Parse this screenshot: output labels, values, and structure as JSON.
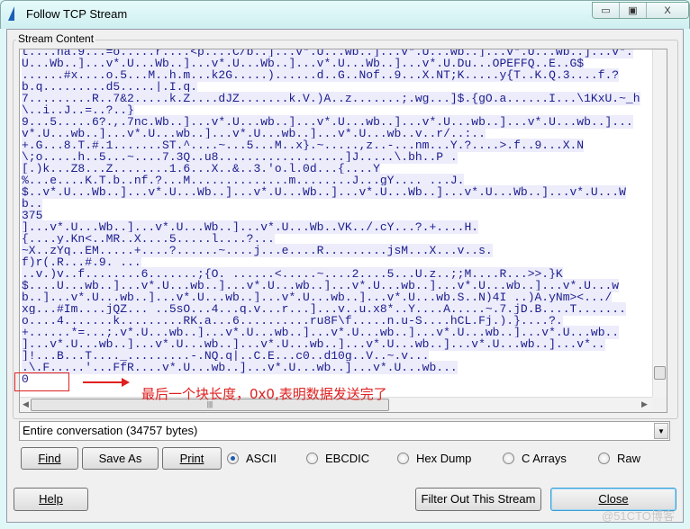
{
  "window": {
    "title": "Follow TCP Stream",
    "minimize": "▭",
    "maximize": "▣",
    "close": "X"
  },
  "group_label": "Stream Content",
  "stream_lines": [
    "t....ha.9...=o.....r....<p....C/b..]...v*.U...wb..]...v*.U...wb..]...v*.U...wb..]...v*.",
    "U...Wb..]...v*.U...Wb..]...v*.U...Wb..]...v*.U...Wb..]...v*.U.Du...OPEFFQ..E..G$",
    "......#x....o.5...M..h.m...k2G.....)......d..G..Nof..9...X.NT;K.....y{T..K.Q.3....f.?",
    "b.q.........d5.....|.I.q.",
    "7.........R..7&2.....k.Z....dJZ.......k.V.)A..z.......;.wg...]$.{gO.a......I...\\1KxU.~_h",
    "\\..i..J..=..?..}",
    "9...5.....6?.,.7nc.Wb..]...v*.U...wb..]...v*.U...wb..]...v*.U...wb..]...v*.U...wb..]...",
    "v*.U...wb..]...v*.U...wb..]...v*.U...wb..]...v*.U...wb..v..r/..:..",
    "+.G...8.T.#.1.......ST.^....~...5...M..x}.~.....,z..-...nm...Y.?....>.f..9...X.N",
    "\\;o.....h..5...~....7.3Q..u8..................]J.....\\.bh..P .",
    "[.)k...Z8...Z........1.6...X..&..3.'o.l.0d...{....Y",
    "%...e....K.T.b..nf.?...M..............m........J...gY.... ...J.",
    "$..v*.U...Wb..]...v*.U...Wb..]...v*.U...Wb..]...v*.U...Wb..]...v*.U...Wb..]...v*.U...W",
    "b..",
    "375",
    "]...v*.U...Wb..]...v*.U...Wb..]...v*.U...Wb..VK../.cY...?.+....H.",
    "{....y.Kn<..MR..X....5.....l....?...",
    "~X..zYq..EM.....+....?......~....j...e....R.........jsM...X...v..s.",
    "f)r(.R...#.9. ...",
    "..v.)v..f........6.......;{O. ......<.....~....2....5...U.z..;;M....R...>>.}K",
    "$....U...wb..]...v*.U...wb..]...v*.U...wb..]...v*.U...wb..]...v*.U...wb..]...v*.U...w",
    "b..]...v*.U...wb..]...v*.U...wb..]...v*.U...wb..]...v*.U...wb.S..N)4I ..)A.yNm><.../",
    "xg...#Im....jQZ... ..5sO...4...q.v...r...]...v..u.x8*..Y....A.....~.7.jD.B....T.......",
    "o....4.......k.........RK.a...6..........ru8F\\f.....n.u-S....hCL.Fj.).}....?.",
    "+......*=...;.v*.U...wb..]...v*.U...wb..]...v*.U...wb..]...v*.U...wb..]...v*.U...wb..",
    "]...v*.U...wb..]...v*.U...wb..]...v*.U...wb..]...v*.U...wb..]...v*.U...wb..]...v*..",
    "]!...B...T...._.........-.NQ.q|..C.E...c0..d10g..V..~.v...",
    ".\\.F.....'...FfR....v*.U...wb..]...v*.U...wb..]...v*.U...wb...",
    "0"
  ],
  "annotation": {
    "text": "最后一个块长度，0x0,表明数据发送完了",
    "color": "#e02020"
  },
  "conversation_select": {
    "value": "Entire conversation (34757 bytes)"
  },
  "buttons": {
    "find": "Find",
    "save_as": "Save As",
    "print": "Print",
    "help": "Help",
    "filter_out": "Filter Out This Stream",
    "close": "Close"
  },
  "format_options": [
    {
      "label": "ASCII",
      "selected": true
    },
    {
      "label": "EBCDIC",
      "selected": false
    },
    {
      "label": "Hex Dump",
      "selected": false
    },
    {
      "label": "C Arrays",
      "selected": false
    },
    {
      "label": "Raw",
      "selected": false
    }
  ],
  "watermark": "@51CTO博客",
  "colors": {
    "stream_text": "#1c1c8c",
    "stream_highlight": "#ececfb",
    "accent": "#3c9fd6"
  }
}
